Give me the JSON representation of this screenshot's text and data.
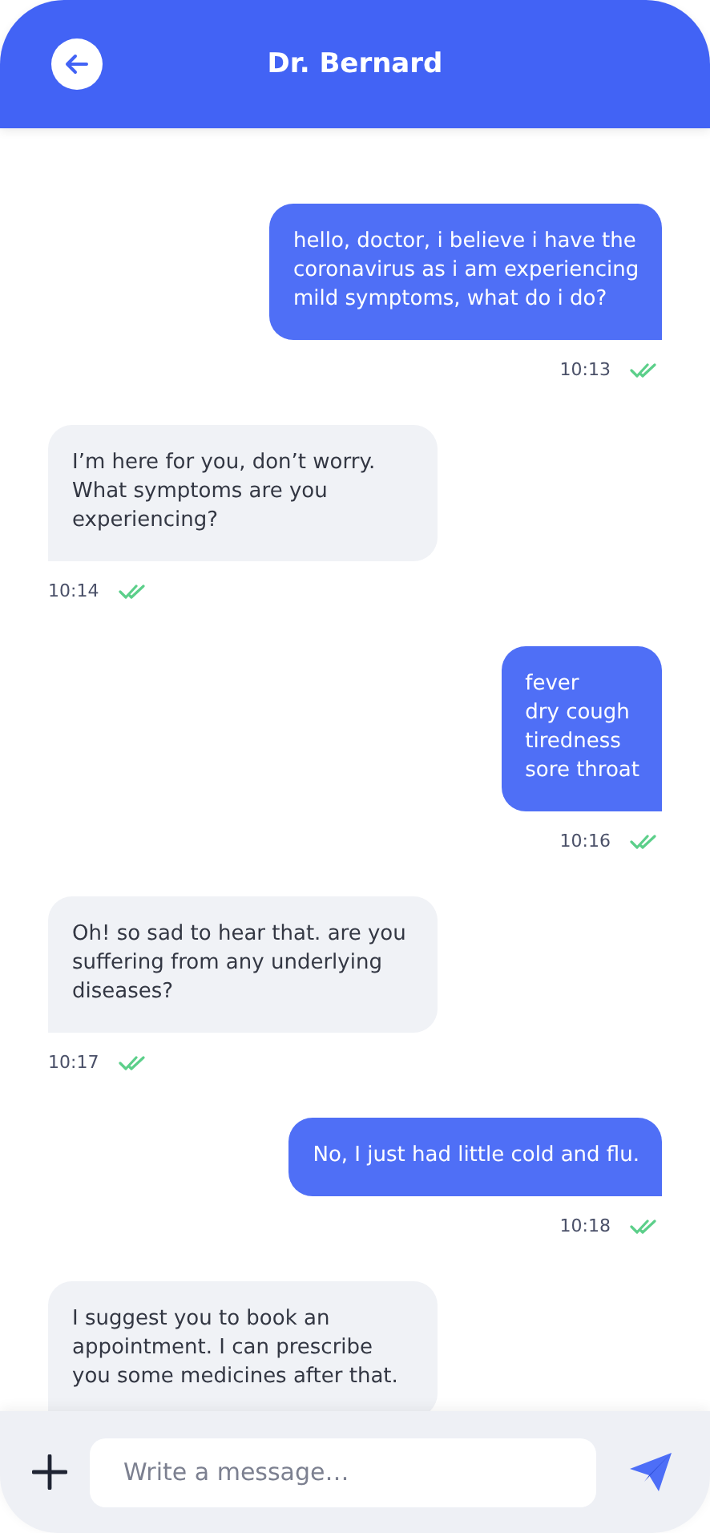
{
  "header": {
    "title": "Dr. Bernard"
  },
  "messages": [
    {
      "kind": "sent",
      "text": "hello, doctor, i believe i have the coronavirus as i am experiencing mild symptoms, what do i do?",
      "time": "10:13",
      "read": true
    },
    {
      "kind": "received",
      "text": "I’m here for you, don’t worry. What symptoms are you experiencing?",
      "time": "10:14",
      "read": true
    },
    {
      "kind": "sent",
      "text": "fever\ndry cough\ntiredness\nsore throat",
      "time": "10:16",
      "read": true
    },
    {
      "kind": "received",
      "text": "Oh! so sad to hear that. are you suffering from any underlying diseases?",
      "time": "10:17",
      "read": true
    },
    {
      "kind": "sent",
      "text": "No, I just had little cold and flu.",
      "time": "10:18",
      "read": true
    },
    {
      "kind": "received",
      "text": "I  suggest you to book an appointment. I can prescribe you some medicines after that."
    }
  ],
  "composer": {
    "placeholder": "Write a message…"
  }
}
